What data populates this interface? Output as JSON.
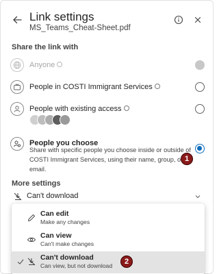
{
  "header": {
    "title": "Link settings",
    "filename": "MS_Teams_Cheat-Sheet.pdf"
  },
  "share": {
    "section_label": "Share the link with",
    "options": [
      {
        "label": "Anyone",
        "state": "disabled"
      },
      {
        "label": "People in COSTI Immigrant Services",
        "state": "unselected"
      },
      {
        "label": "People with existing access",
        "state": "unselected"
      },
      {
        "label": "People you choose",
        "state": "selected",
        "description": "Share with specific people you choose inside or outside of COSTI Immigrant Services, using their name, group, or email."
      }
    ],
    "avatar_colors": [
      "#c9c9c9",
      "#b8b8b8",
      "#a9a9a9",
      "#6d6d6d",
      "#9a9a9a"
    ]
  },
  "more": {
    "section_label": "More settings",
    "selected_value": "Can't download"
  },
  "menu": {
    "items": [
      {
        "title": "Can edit",
        "subtitle": "Make any changes",
        "icon": "pencil-icon"
      },
      {
        "title": "Can view",
        "subtitle": "Can't make changes",
        "icon": "eye-icon"
      },
      {
        "title": "Can't download",
        "subtitle": "Can view, but not download",
        "icon": "no-download-icon",
        "selected": true
      }
    ]
  },
  "annotations": {
    "badge_1": "1",
    "badge_2": "2"
  },
  "colors": {
    "accent": "#0f6cbd",
    "badge": "#8b1a1a"
  }
}
